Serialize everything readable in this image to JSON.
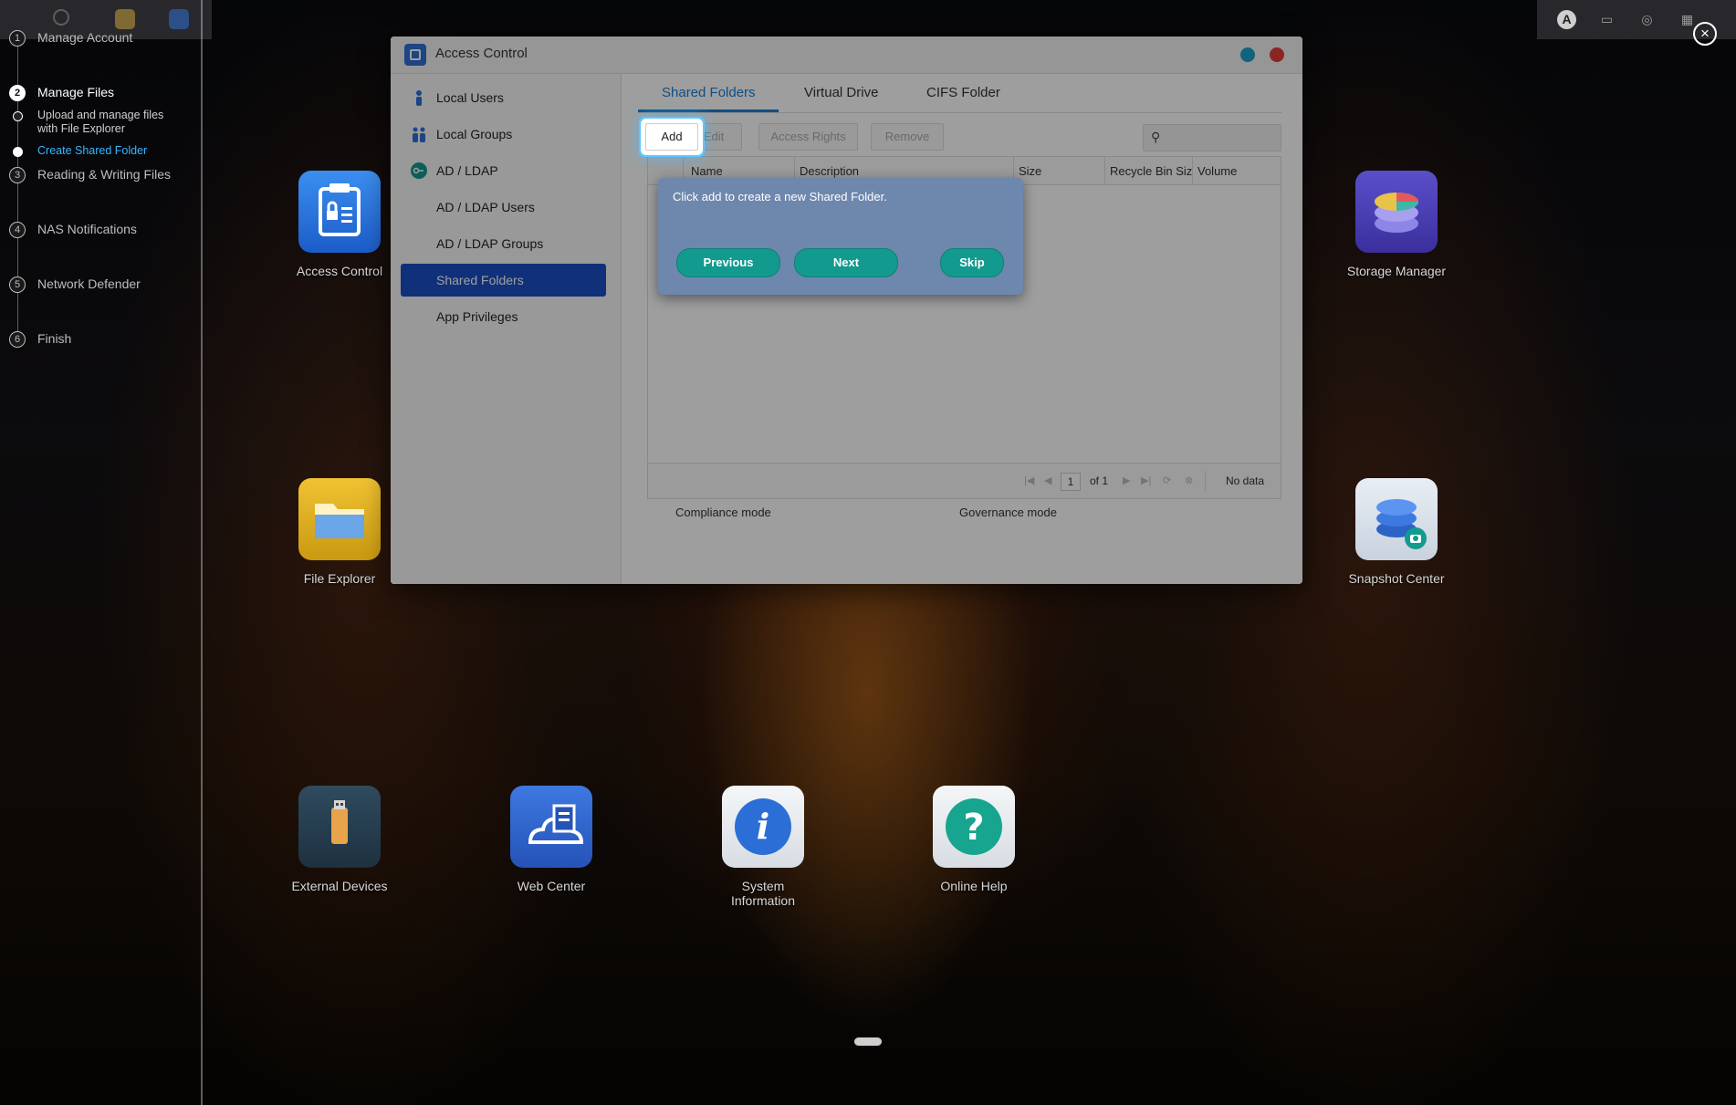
{
  "tutorial": {
    "steps": [
      {
        "num": "1",
        "label": "Manage Account"
      },
      {
        "num": "2",
        "label": "Manage Files"
      },
      {
        "num": "3",
        "label": "Reading & Writing Files"
      },
      {
        "num": "4",
        "label": "NAS Notifications"
      },
      {
        "num": "5",
        "label": "Network Defender"
      },
      {
        "num": "6",
        "label": "Finish"
      }
    ],
    "substeps": [
      {
        "label": "Upload and manage files with File Explorer"
      },
      {
        "label": "Create Shared Folder"
      }
    ]
  },
  "desktop": {
    "apps": [
      {
        "name": "Access Control"
      },
      {
        "name": "Storage Manager"
      },
      {
        "name": "File Explorer"
      },
      {
        "name": "Snapshot Center"
      },
      {
        "name": "External Devices"
      },
      {
        "name": "Web Center"
      },
      {
        "name": "System Information"
      },
      {
        "name": "Online Help"
      }
    ]
  },
  "tray": {
    "user_initial": "A"
  },
  "window": {
    "title": "Access Control",
    "nav": [
      {
        "label": "Local Users"
      },
      {
        "label": "Local Groups"
      },
      {
        "label": "AD / LDAP"
      },
      {
        "label": "AD / LDAP Users"
      },
      {
        "label": "AD / LDAP Groups"
      },
      {
        "label": "Shared Folders"
      },
      {
        "label": "App Privileges"
      }
    ],
    "tabs": [
      {
        "label": "Shared Folders"
      },
      {
        "label": "Virtual Drive"
      },
      {
        "label": "CIFS Folder"
      }
    ],
    "toolbar": {
      "add": "Add",
      "edit": "Edit",
      "access_rights": "Access Rights",
      "remove": "Remove"
    },
    "columns": [
      "Name",
      "Description",
      "Size",
      "Recycle Bin Siz",
      "Volume"
    ],
    "pager": {
      "page": "1",
      "of": "of 1",
      "status": "No data"
    },
    "modes": {
      "compliance": "Compliance mode",
      "governance": "Governance mode"
    }
  },
  "tooltip": {
    "message": "Click add to create a new Shared Folder.",
    "previous": "Previous",
    "next": "Next",
    "skip": "Skip"
  },
  "colors": {
    "accent": "#1a7fd6",
    "nav_active": "#1a4fc4",
    "tip_bg": "#6e87ad",
    "tip_button": "#139a8f"
  }
}
